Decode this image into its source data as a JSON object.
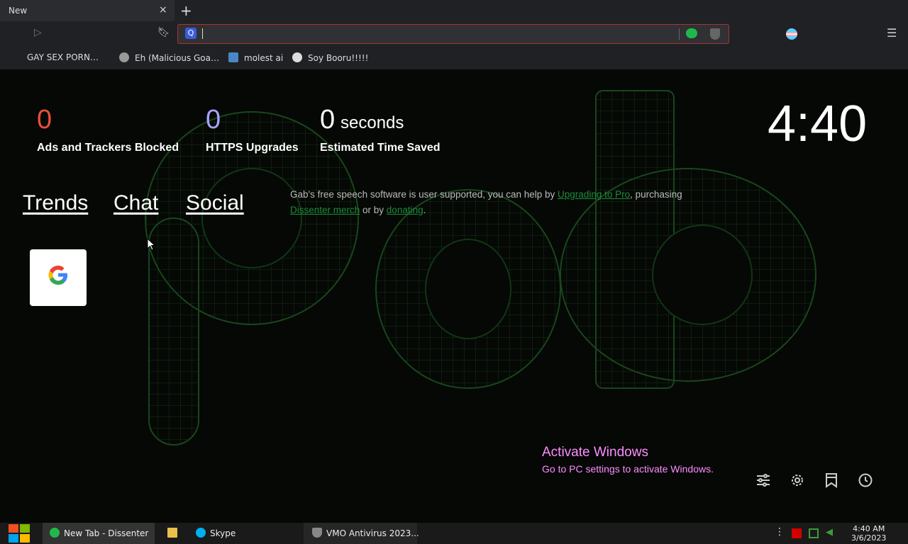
{
  "browser": {
    "tab_title": "New",
    "tab_close": "×",
    "new_tab": "+",
    "menu_glyph": "☰",
    "omnibox": {
      "value": "",
      "search_badge": "Q"
    },
    "bookmarks": [
      {
        "label": "GAY SEX PORN…",
        "icon": "globe-icon"
      },
      {
        "label": "Eh (Malicious Goa…",
        "icon": "globe-icon"
      },
      {
        "label": "molest ai",
        "icon": "site-icon"
      },
      {
        "label": "Soy Booru!!!!!",
        "icon": "site-icon"
      }
    ]
  },
  "stats": [
    {
      "value": "0",
      "label": "Ads and Trackers Blocked",
      "color": "#e8503a"
    },
    {
      "value": "0",
      "label": "HTTPS Upgrades",
      "color": "#a7a3ff"
    },
    {
      "value": "0",
      "unit": "seconds",
      "label": "Estimated Time Saved",
      "color": "#ffffff"
    }
  ],
  "clock": "4:40",
  "nav_links": [
    "Trends",
    "Chat",
    "Social"
  ],
  "support": {
    "text1": "Gab's free speech software is user supported, you can help by ",
    "link1": "Upgrading to Pro",
    "text2": ", purchasing ",
    "link2": "Dissenter merch",
    "text3": " or by ",
    "link3": "donating",
    "text4": "."
  },
  "top_sites": [
    {
      "name": "Google",
      "icon": "google-icon"
    }
  ],
  "watermark": {
    "title": "Activate Windows",
    "subtitle": "Go to PC settings to activate Windows.",
    "color": "#ff8cff"
  },
  "page_actions": [
    "customize-icon",
    "settings-icon",
    "bookmarks-icon",
    "history-icon"
  ],
  "taskbar": {
    "items": [
      {
        "label": "New Tab - Dissenter",
        "icon": "dissenter-icon"
      },
      {
        "label": "",
        "icon": "folder-icon"
      },
      {
        "label": "Skype",
        "icon": "skype-icon"
      },
      {
        "label": "VMO Antivirus 2023...",
        "icon": "shield-icon"
      }
    ],
    "time": "4:40 AM",
    "date": "3/6/2023"
  },
  "colors": {
    "accent_green": "#21b84b",
    "chrome_bg": "#202124",
    "page_bg": "#050805"
  }
}
